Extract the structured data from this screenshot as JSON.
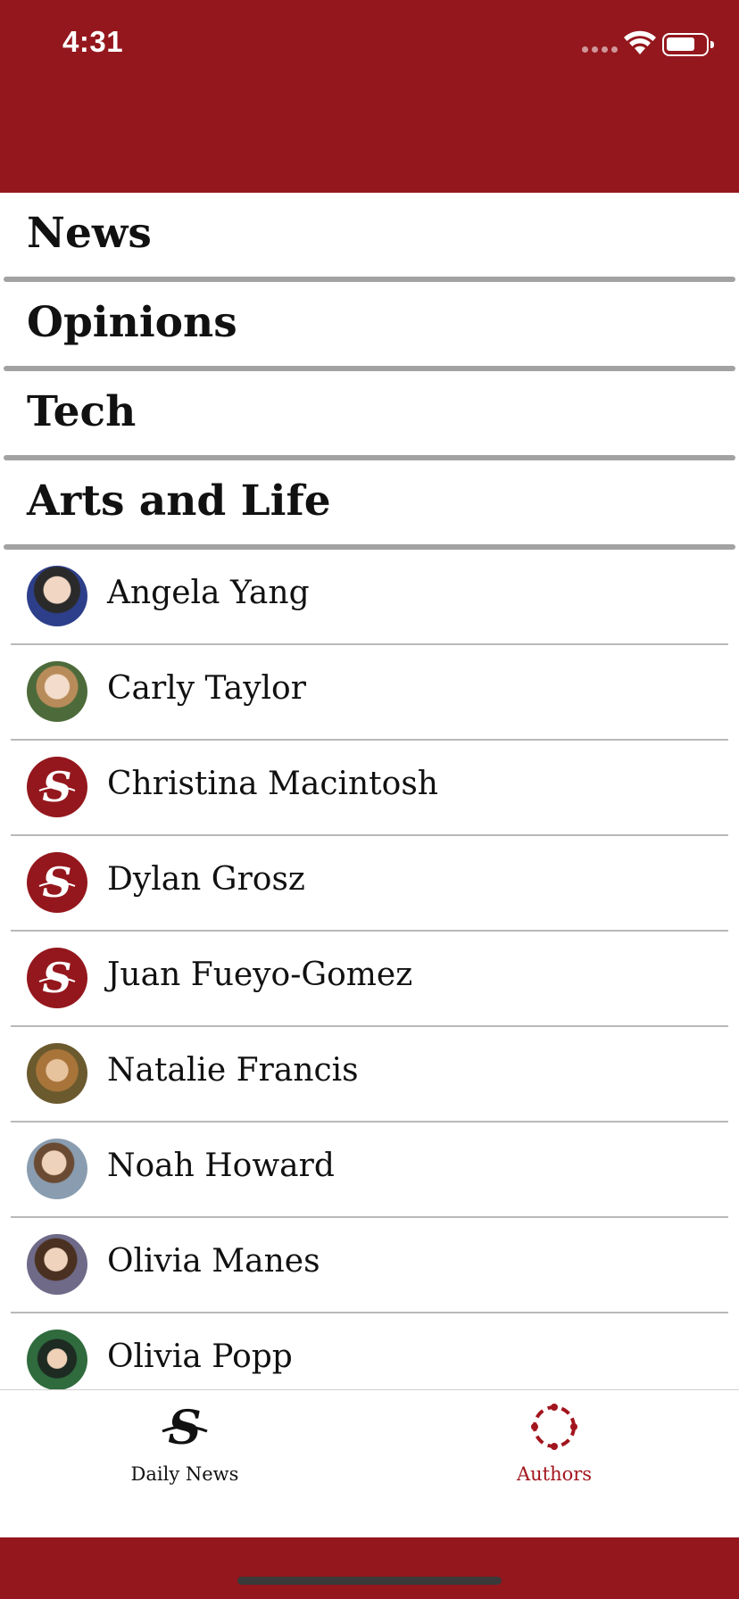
{
  "status_bar": {
    "time": "4:31"
  },
  "sections": [
    {
      "label": "News"
    },
    {
      "label": "Opinions"
    },
    {
      "label": "Tech"
    },
    {
      "label": "Arts and Life"
    }
  ],
  "authors": [
    {
      "name": "Angela Yang",
      "avatar": "photo"
    },
    {
      "name": "Carly Taylor",
      "avatar": "photo"
    },
    {
      "name": "Christina Macintosh",
      "avatar": "stanford-daily-logo"
    },
    {
      "name": "Dylan Grosz",
      "avatar": "stanford-daily-logo"
    },
    {
      "name": "Juan Fueyo-Gomez",
      "avatar": "stanford-daily-logo"
    },
    {
      "name": "Natalie Francis",
      "avatar": "photo"
    },
    {
      "name": "Noah Howard",
      "avatar": "photo"
    },
    {
      "name": "Olivia Manes",
      "avatar": "photo"
    },
    {
      "name": "Olivia Popp",
      "avatar": "photo"
    }
  ],
  "tab_bar": {
    "tabs": [
      {
        "label": "Daily News",
        "icon": "daily-logo-icon",
        "selected": false
      },
      {
        "label": "Authors",
        "icon": "authors-ring-icon",
        "selected": true
      }
    ]
  },
  "colors": {
    "brand_red": "#94171d",
    "selected_tab": "#a3151e",
    "divider": "#a2a2a2"
  }
}
